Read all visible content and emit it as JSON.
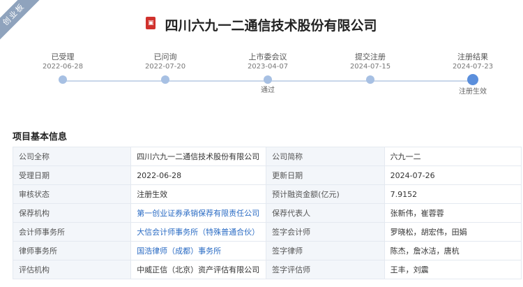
{
  "ribbon": "创业板",
  "title": "四川六九一二通信技术股份有限公司",
  "timeline": [
    {
      "label": "已受理",
      "date": "2022-06-28",
      "sub": ""
    },
    {
      "label": "已问询",
      "date": "2022-07-20",
      "sub": ""
    },
    {
      "label": "上市委会议",
      "date": "2023-04-07",
      "sub": "通过"
    },
    {
      "label": "提交注册",
      "date": "2024-07-15",
      "sub": ""
    },
    {
      "label": "注册结果",
      "date": "2024-07-23",
      "sub": "注册生效"
    }
  ],
  "section_title": "项目基本信息",
  "rows": [
    {
      "k1": "公司全称",
      "v1": "四川六九一二通信技术股份有限公司",
      "k2": "公司简称",
      "v2": "六九一二"
    },
    {
      "k1": "受理日期",
      "v1": "2022-06-28",
      "k2": "更新日期",
      "v2": "2024-07-26"
    },
    {
      "k1": "审核状态",
      "v1": "注册生效",
      "k2": "预计融资金额(亿元)",
      "v2": "7.9152"
    },
    {
      "k1": "保荐机构",
      "v1": "第一创业证券承销保荐有限责任公司",
      "k2": "保荐代表人",
      "v2": "张新伟，崔蓉蓉"
    },
    {
      "k1": "会计师事务所",
      "v1": "大信会计师事务所（特殊普通合伙）",
      "k2": "签字会计师",
      "v2": "罗晓松，胡宏伟，田娟"
    },
    {
      "k1": "律师事务所",
      "v1": "国浩律师（成都）事务所",
      "k2": "签字律师",
      "v2": "陈杰，詹冰洁，唐杭"
    },
    {
      "k1": "评估机构",
      "v1": "中威正信（北京）资产评估有限公司",
      "k2": "签字评估师",
      "v2": "王丰，刘震"
    }
  ]
}
